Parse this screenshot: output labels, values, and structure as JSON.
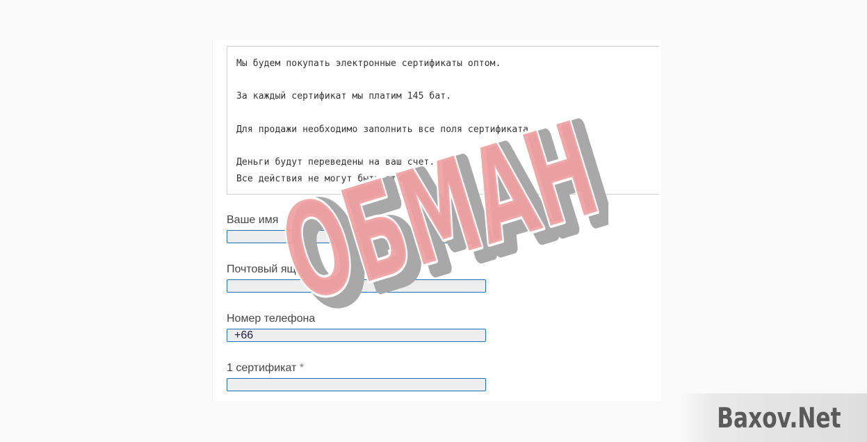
{
  "notice": {
    "line1": "Мы будем покупать электронные сертификаты оптом.",
    "line2": "За каждый сертификат мы платим 145 бат.",
    "line3": "Для продажи необходимо заполнить все поля сертификата.",
    "line4": "Деньги будут переведены на ваш счет.",
    "line5": "Все действия не могут быть отменены."
  },
  "form": {
    "name_label": "Ваше имя",
    "name_value": "",
    "email_label": "Почтовый ящик",
    "email_required": "*",
    "email_value": "",
    "phone_label": "Номер телефона",
    "phone_value": "+66",
    "cert_label": "1 сертификат",
    "cert_required": "*",
    "cert_value": ""
  },
  "stamp": {
    "text": "ОБМАН",
    "fill_color": "#f0a0a0",
    "shadow_color": "#a8a8a8"
  },
  "watermark": {
    "text": "Baxov.Net"
  }
}
